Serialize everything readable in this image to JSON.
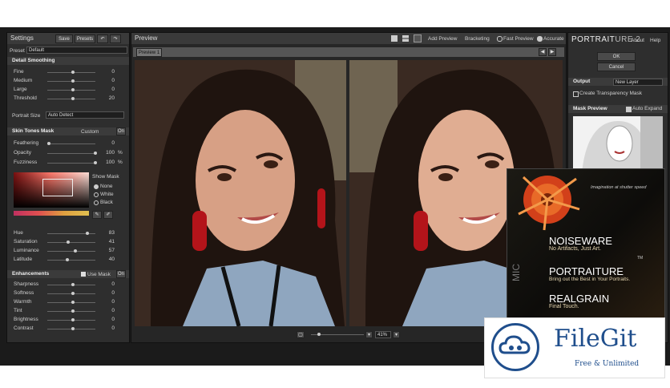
{
  "settings": {
    "title": "Settings",
    "save": "Save",
    "presets": "Presets",
    "preset_label": "Preset",
    "preset_value": "Default",
    "detail_title": "Detail Smoothing",
    "detail_rows": [
      {
        "label": "Fine",
        "value": "0"
      },
      {
        "label": "Medium",
        "value": "0"
      },
      {
        "label": "Large",
        "value": "0"
      },
      {
        "label": "Threshold",
        "value": "20"
      }
    ],
    "portrait_size_label": "Portrait Size",
    "portrait_size_value": "Auto Detect",
    "skin_title": "Skin Tones Mask",
    "skin_mode": "Custom",
    "skin_on": "On",
    "skin_rows": [
      {
        "label": "Feathering",
        "value": "0"
      },
      {
        "label": "Opacity",
        "value": "100",
        "unit": "%"
      },
      {
        "label": "Fuzziness",
        "value": "100",
        "unit": "%"
      }
    ],
    "show_mask": "Show Mask",
    "mask_options": [
      "None",
      "White",
      "Black"
    ],
    "hsl_rows": [
      {
        "label": "Hue",
        "value": "83"
      },
      {
        "label": "Saturation",
        "value": "41"
      },
      {
        "label": "Luminance",
        "value": "57"
      },
      {
        "label": "Latitude",
        "value": "40"
      }
    ],
    "enh_title": "Enhancements",
    "use_mask": "Use Mask",
    "enh_on": "On",
    "enh_rows": [
      {
        "label": "Sharpness",
        "value": "0"
      },
      {
        "label": "Softness",
        "value": "0"
      },
      {
        "label": "Warmth",
        "value": "0"
      },
      {
        "label": "Tint",
        "value": "0"
      },
      {
        "label": "Brightness",
        "value": "0"
      },
      {
        "label": "Contrast",
        "value": "0"
      }
    ]
  },
  "preview": {
    "title": "Preview",
    "tab": "Preview 1",
    "add_preview": "Add Preview",
    "bracketing": "Bracketing",
    "fast_preview": "Fast Preview",
    "accurate": "Accurate",
    "zoom": "41%"
  },
  "right": {
    "brand_a": "PORTRAIT",
    "brand_b": "URE 2",
    "about": "About",
    "help": "Help",
    "ok": "OK",
    "cancel": "Cancel",
    "output_label": "Output",
    "output_value": "New Layer",
    "create_transparency": "Create Transparency Mask",
    "mask_preview": "Mask Preview",
    "auto_expand": "Auto Expand"
  },
  "box": {
    "tagline": "Imagination at shutter speed",
    "noiseware": "NOISEWARE",
    "noiseware_sub": "No Artifacts, Just Art.",
    "portraiture": "PORTRAITURE",
    "portraiture_sub": "Bring out the Best in Your Portraits.",
    "realgrain": "REALGRAIN",
    "realgrain_sub": "Final Touch.",
    "tm": "TM",
    "side": "MIC"
  },
  "watermark": {
    "name": "FileGit",
    "tagline": "Free & Unlimited"
  },
  "colors": {
    "accent": "#cfcfcf",
    "panel": "#2e2e2e",
    "brand_blue": "#1f4e8c"
  }
}
